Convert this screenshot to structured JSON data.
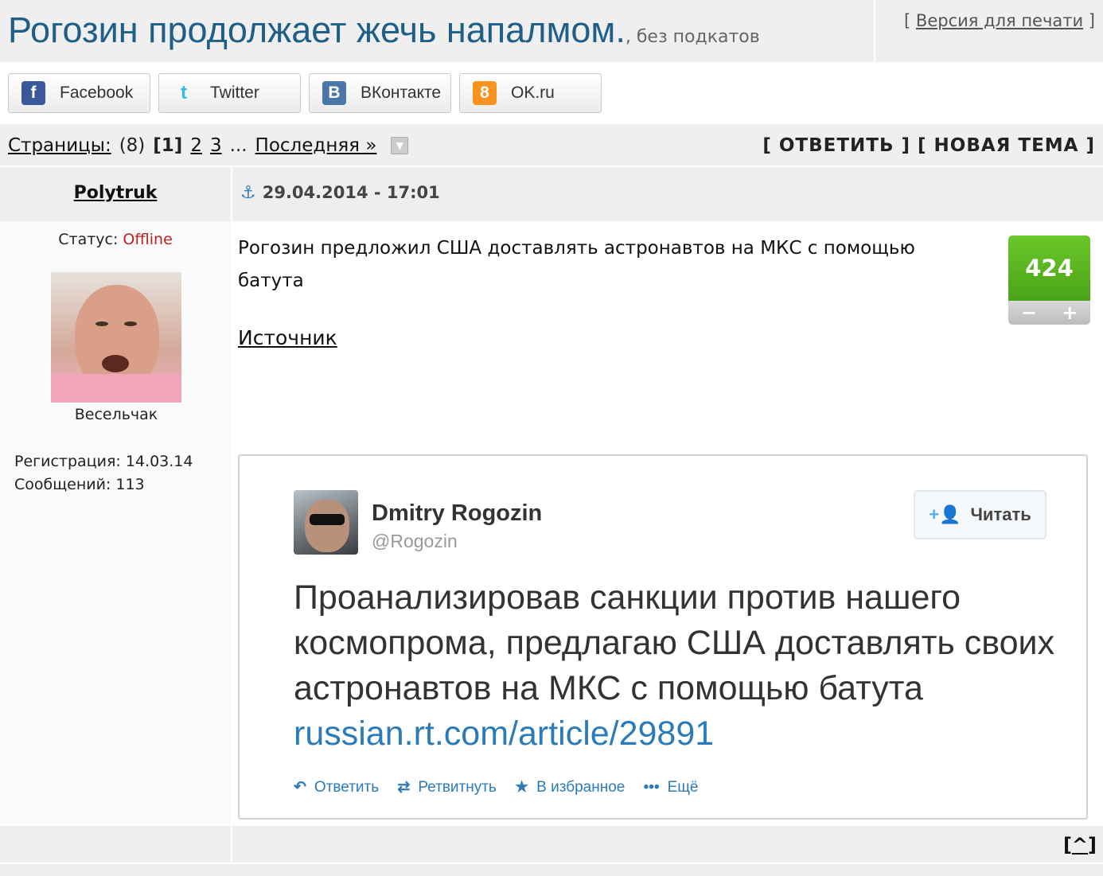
{
  "topic": {
    "title": "Рогозин продолжает жечь напалмом.",
    "description": ", без подкатов",
    "print_prefix": "[ ",
    "print_link": "Версия для печати",
    "print_suffix": " ]"
  },
  "share": [
    {
      "label": "Facebook",
      "icon": "facebook-icon",
      "glyph": "f",
      "color": "#3b5998"
    },
    {
      "label": "Twitter",
      "icon": "twitter-icon",
      "glyph": "t",
      "color": "#33bbee"
    },
    {
      "label": "ВКонтакте",
      "icon": "vk-icon",
      "glyph": "В",
      "color": "#4a76a8"
    },
    {
      "label": "OK.ru",
      "icon": "ok-icon",
      "glyph": "8",
      "color": "#f7931e"
    }
  ],
  "pager": {
    "label": "Страницы:",
    "count": "(8)",
    "current": "[1]",
    "page2": "2",
    "page3": "3",
    "ellipsis": "...",
    "last": "Последняя »"
  },
  "actions": {
    "reply": "[ ОТВЕТИТЬ ]",
    "new_topic": "[ НОВАЯ ТЕМА ]"
  },
  "post": {
    "author": "Polytruk",
    "date": "29.04.2014 - 17:01",
    "status_label": "Статус: ",
    "status_value": "Offline",
    "rank": "Весельчак",
    "registration": "Регистрация: 14.03.14",
    "messages": "Сообщений: 113",
    "text": "Рогозин предложил США доставлять астронавтов на МКС с помощью батута",
    "source_link": "Источник",
    "rating": "424",
    "rating_minus": "−",
    "rating_plus": "+"
  },
  "tweet": {
    "name": "Dmitry Rogozin",
    "handle": "@Rogozin",
    "follow": "Читать",
    "text": "Проанализировав санкции против нашего космопрома, предлагаю США доставлять своих астронавтов на МКС с помощью батута ",
    "link": "russian.rt.com/article/29891",
    "reply": "Ответить",
    "retweet": "Ретвитнуть",
    "favorite": "В избранное",
    "more": "Ещё"
  },
  "footer": {
    "to_top": "^"
  },
  "colors": {
    "title": "#1f5f87",
    "offline": "#bb2222",
    "rating_green": "#56ad1e",
    "tweet_link": "#2b7bb9"
  }
}
